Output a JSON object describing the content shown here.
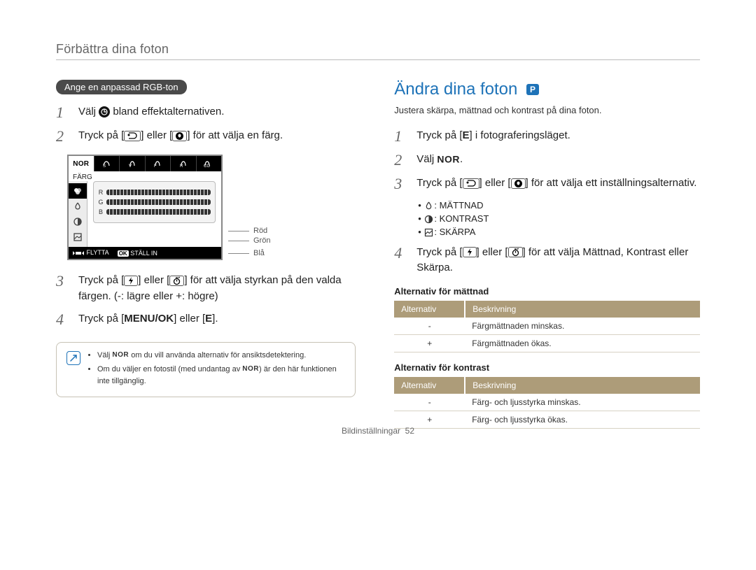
{
  "page": {
    "header": "Förbättra dina foton",
    "footer_label": "Bildinställningar",
    "footer_page": "52"
  },
  "left": {
    "pill": "Ange en anpassad RGB-ton",
    "steps": [
      {
        "num": "1",
        "prefix": "Välj ",
        "suffix": " bland effektalternativen."
      },
      {
        "num": "2",
        "text_a": "Tryck på [",
        "text_b": "] eller [",
        "text_c": "] för att välja en färg."
      },
      {
        "num": "3",
        "text_a": "Tryck på [",
        "text_b": "] eller [",
        "text_c": "] för att välja styrkan på den valda färgen. (-: lägre eller +: högre)"
      },
      {
        "num": "4",
        "text_a": "Tryck på [",
        "menu_ok": "MENU/OK",
        "text_b": "] eller [",
        "e": "E",
        "text_c": "]."
      }
    ],
    "camera": {
      "active_tab": "NOR",
      "title": "FÄRG",
      "rgb_labels": [
        "R",
        "G",
        "B"
      ],
      "footer_move": "FLYTTA",
      "footer_ok": "OK",
      "footer_set": "STÄLL IN",
      "callouts": [
        "Röd",
        "Grön",
        "Blå"
      ]
    },
    "notes": [
      {
        "a": "Välj ",
        "b": " om du vill använda alternativ för ansiktsdetektering."
      },
      {
        "a": "Om du väljer en fotostil (med undantag av ",
        "b": ") är den här funktionen inte tillgänglig."
      }
    ],
    "note_nor": "NOR"
  },
  "right": {
    "title": "Ändra dina foton",
    "mode": "P",
    "sub": "Justera skärpa, mättnad och kontrast på dina foton.",
    "steps": [
      {
        "num": "1",
        "text_a": "Tryck på [",
        "e": "E",
        "text_b": "] i fotograferingsläget."
      },
      {
        "num": "2",
        "text_a": "Välj ",
        "text_b": "."
      },
      {
        "num": "3",
        "text_a": "Tryck på [",
        "text_b": "] eller [",
        "text_c": "] för att välja ett inställningsalternativ."
      },
      {
        "num": "4",
        "text_a": "Tryck på [",
        "text_b": "] eller [",
        "text_c": "] för att välja Mättnad, Kontrast eller Skärpa."
      }
    ],
    "dot_items": [
      {
        "label": "MÄTTNAD"
      },
      {
        "label": "KONTRAST"
      },
      {
        "label": "SKÄRPA"
      }
    ],
    "nor": "NOR",
    "table1_head": "Alternativ för mättnad",
    "table2_head": "Alternativ för kontrast",
    "th": {
      "opt": "Alternativ",
      "desc": "Beskrivning"
    },
    "table1": [
      {
        "opt": "-",
        "desc": "Färgmättnaden minskas."
      },
      {
        "opt": "+",
        "desc": "Färgmättnaden ökas."
      }
    ],
    "table2": [
      {
        "opt": "-",
        "desc": "Färg- och ljusstyrka minskas."
      },
      {
        "opt": "+",
        "desc": "Färg- och ljusstyrka ökas."
      }
    ]
  }
}
